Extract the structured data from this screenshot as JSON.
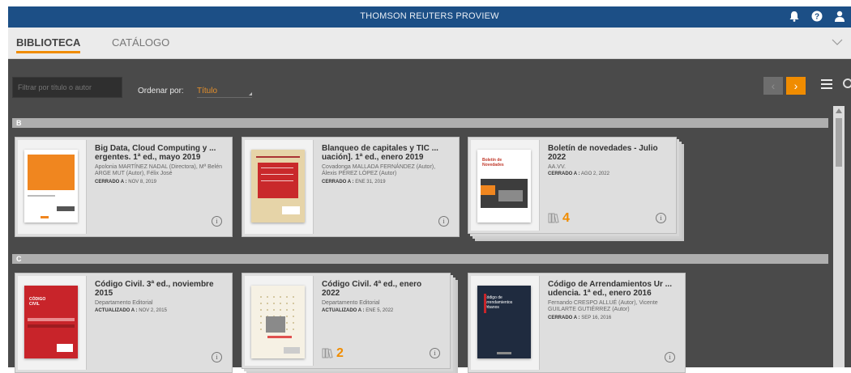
{
  "header": {
    "title": "THOMSON REUTERS PROVIEW",
    "icons": [
      "bell-icon",
      "help-icon",
      "user-icon"
    ]
  },
  "tabs": [
    {
      "label": "BIBLIOTECA",
      "active": true
    },
    {
      "label": "CATÁLOGO",
      "active": false
    }
  ],
  "toolbar": {
    "filter_placeholder": "Filtrar por título o autor",
    "sort_label": "Ordenar por:",
    "sort_value": "Título",
    "prev_arrow": "‹",
    "next_arrow": "›"
  },
  "sections": [
    {
      "letter": "B",
      "books": [
        {
          "title": "Big Data, Cloud Computing y ... ergentes. 1ª ed., mayo 2019",
          "authors": "Apolonia MARTÍNEZ NADAL (Directora), Mª Belén ARGE MUT (Autor), Félix José",
          "status_label": "CERRADO A :",
          "status_date": "NOV 8, 2019",
          "editions": ""
        },
        {
          "title": "Blanqueo de capitales y TIC ... uación]. 1ª ed., enero 2019",
          "authors": "Covadonga MALLADA FERNÁNDEZ (Autor), Álexis PÉREZ LÓPEZ (Autor)",
          "status_label": "CERRADO A :",
          "status_date": "ENE 31, 2019",
          "editions": ""
        },
        {
          "title": "Boletín de novedades - Julio 2022",
          "authors": "AA.VV.",
          "status_label": "CERRADO A :",
          "status_date": "AGO 2, 2022",
          "editions": "4"
        }
      ]
    },
    {
      "letter": "C",
      "books": [
        {
          "title": "Código Civil. 3ª ed., noviembre 2015",
          "authors": "Departamento Editorial",
          "status_label": "ACTUALIZADO A :",
          "status_date": "NOV 2, 2015",
          "editions": ""
        },
        {
          "title": "Código Civil. 4ª ed., enero 2022",
          "authors": "Departamento Editorial",
          "status_label": "ACTUALIZADO A :",
          "status_date": "ENE 5, 2022",
          "editions": "2"
        },
        {
          "title": "Código de Arrendamientos Ur ... udencia. 1ª ed., enero 2016",
          "authors": "Fernando CRESPO ALLUÉ (Autor), Vicente GUILARTE GUTIÉRREZ (Autor)",
          "status_label": "CERRADO A :",
          "status_date": "SEP 16, 2016",
          "editions": ""
        }
      ]
    }
  ],
  "colors": {
    "header_bg": "#1c4f86",
    "accent": "#f08c00",
    "main_bg": "#4a4a4a"
  }
}
